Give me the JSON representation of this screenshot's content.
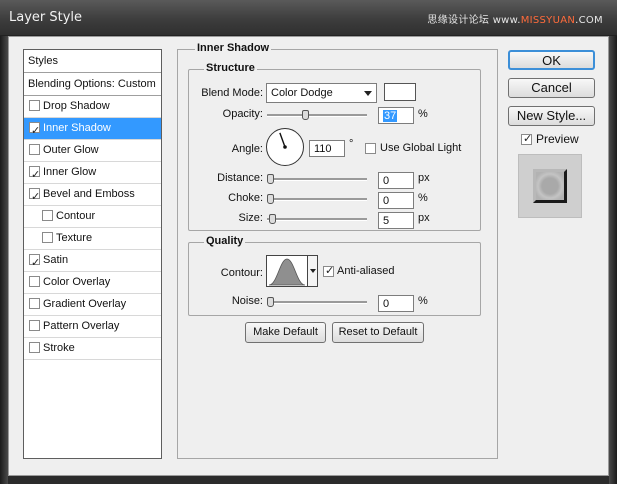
{
  "window": {
    "title": "Layer Style",
    "watermark_main": "思缘设计论坛  www.",
    "watermark_accent": "MISSYUAN",
    "watermark_end": ".COM"
  },
  "styles_panel": {
    "header": "Styles",
    "blending_options": "Blending Options: Custom",
    "items": [
      {
        "label": "Drop Shadow",
        "checked": false,
        "selected": false,
        "sub": false
      },
      {
        "label": "Inner Shadow",
        "checked": true,
        "selected": true,
        "sub": false
      },
      {
        "label": "Outer Glow",
        "checked": false,
        "selected": false,
        "sub": false
      },
      {
        "label": "Inner Glow",
        "checked": true,
        "selected": false,
        "sub": false
      },
      {
        "label": "Bevel and Emboss",
        "checked": true,
        "selected": false,
        "sub": false
      },
      {
        "label": "Contour",
        "checked": false,
        "selected": false,
        "sub": true
      },
      {
        "label": "Texture",
        "checked": false,
        "selected": false,
        "sub": true
      },
      {
        "label": "Satin",
        "checked": true,
        "selected": false,
        "sub": false
      },
      {
        "label": "Color Overlay",
        "checked": false,
        "selected": false,
        "sub": false
      },
      {
        "label": "Gradient Overlay",
        "checked": false,
        "selected": false,
        "sub": false
      },
      {
        "label": "Pattern Overlay",
        "checked": false,
        "selected": false,
        "sub": false
      },
      {
        "label": "Stroke",
        "checked": false,
        "selected": false,
        "sub": false
      }
    ]
  },
  "inner_shadow": {
    "section_title": "Inner Shadow",
    "structure": {
      "title": "Structure",
      "blend_mode_label": "Blend Mode:",
      "blend_mode_value": "Color Dodge",
      "blend_color": "#ffffff",
      "opacity_label": "Opacity:",
      "opacity_value": "37",
      "opacity_unit": "%",
      "angle_label": "Angle:",
      "angle_value": "110",
      "angle_unit": "°",
      "use_global_light_label": "Use Global Light",
      "use_global_light_checked": false,
      "distance_label": "Distance:",
      "distance_value": "0",
      "distance_unit": "px",
      "choke_label": "Choke:",
      "choke_value": "0",
      "choke_unit": "%",
      "size_label": "Size:",
      "size_value": "5",
      "size_unit": "px"
    },
    "quality": {
      "title": "Quality",
      "contour_label": "Contour:",
      "anti_aliased_label": "Anti-aliased",
      "anti_aliased_checked": true,
      "noise_label": "Noise:",
      "noise_value": "0",
      "noise_unit": "%"
    },
    "make_default_label": "Make Default",
    "reset_default_label": "Reset to Default"
  },
  "actions": {
    "ok_label": "OK",
    "cancel_label": "Cancel",
    "new_style_label": "New Style...",
    "preview_label": "Preview",
    "preview_checked": true
  }
}
